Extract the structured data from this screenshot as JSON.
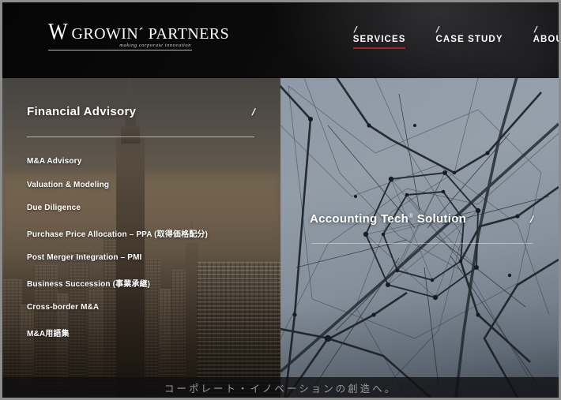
{
  "header": {
    "logo": {
      "mark": "W",
      "name_part1": "G",
      "name_rest1": "ROWIN´ ",
      "name_part2": "P",
      "name_rest2": "ARTNERS",
      "full_name": "Growin´ Partners",
      "tagline": "making corporate innovation"
    },
    "nav": [
      {
        "label": "SERVICES",
        "slash": "/",
        "active": true
      },
      {
        "label": "CASE STUDY",
        "slash": "/",
        "active": false
      },
      {
        "label": "ABOUT",
        "slash": "/",
        "active": false
      }
    ],
    "accent_color": "#a32424"
  },
  "panels": {
    "left": {
      "title": "Financial Advisory",
      "slash": "/",
      "artwork": "new-york-city-skyline-photo",
      "items": [
        {
          "label": "M&A Advisory"
        },
        {
          "label": "Valuation & Modeling"
        },
        {
          "label": "Due Diligence"
        },
        {
          "label": "Purchase Price Allocation – PPA (取得価格配分)"
        },
        {
          "label": "Post Merger Integration – PMI"
        },
        {
          "label": "Business Succession (事業承継)"
        },
        {
          "label": "Cross-border M&A"
        },
        {
          "label": "M&A用語集"
        }
      ]
    },
    "right": {
      "title": "Accounting Tech",
      "title_sup": "®",
      "title_suffix": " Solution",
      "slash": "/",
      "artwork": "abstract-network-web-photo"
    }
  },
  "bottom": {
    "tagline": "コーポレート・イノベーションの創造へ。"
  }
}
